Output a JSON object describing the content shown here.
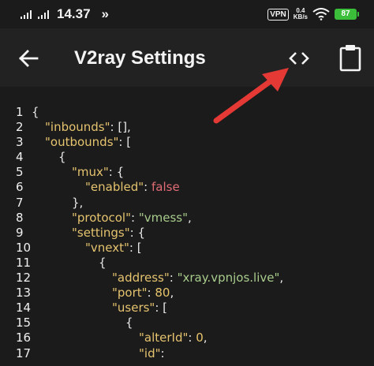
{
  "status_bar": {
    "time": "14.37",
    "overflow": "»",
    "vpn": "VPN",
    "net_speed_value": "0.4",
    "net_speed_unit": "KB/s",
    "battery": "87",
    "icons": [
      "signal-icon",
      "wifi-icon",
      "battery-icon"
    ]
  },
  "app_bar": {
    "title": "V2ray Settings",
    "back_icon": "arrow-left-icon",
    "code_icon": "code-brackets-icon",
    "clipboard_icon": "clipboard-icon"
  },
  "annotation": {
    "arrow_color": "#e53935"
  },
  "colors": {
    "key": "#e5c36f",
    "string": "#a8cc8c",
    "number": "#e8c56a",
    "boolean": "#e06c75",
    "background": "#1b1b1b"
  },
  "code": {
    "lines": [
      {
        "n": "1",
        "parts": [
          {
            "t": "{",
            "c": "p"
          }
        ]
      },
      {
        "n": "2",
        "parts": [
          {
            "t": "\"inbounds\"",
            "c": "k"
          },
          {
            "t": ": [],",
            "c": "p"
          }
        ]
      },
      {
        "n": "3",
        "parts": [
          {
            "t": "\"outbounds\"",
            "c": "k"
          },
          {
            "t": ": [",
            "c": "p"
          }
        ]
      },
      {
        "n": "4",
        "parts": [
          {
            "t": "{",
            "c": "p"
          }
        ]
      },
      {
        "n": "5",
        "parts": [
          {
            "t": "\"mux\"",
            "c": "k"
          },
          {
            "t": ": {",
            "c": "p"
          }
        ]
      },
      {
        "n": "6",
        "parts": [
          {
            "t": "\"enabled\"",
            "c": "k"
          },
          {
            "t": ": ",
            "c": "p"
          },
          {
            "t": "false",
            "c": "bool"
          }
        ]
      },
      {
        "n": "7",
        "parts": [
          {
            "t": "},",
            "c": "p"
          }
        ]
      },
      {
        "n": "8",
        "parts": [
          {
            "t": "\"protocol\"",
            "c": "k"
          },
          {
            "t": ": ",
            "c": "p"
          },
          {
            "t": "\"vmess\"",
            "c": "s"
          },
          {
            "t": ",",
            "c": "p"
          }
        ]
      },
      {
        "n": "9",
        "parts": [
          {
            "t": "\"settings\"",
            "c": "k"
          },
          {
            "t": ": {",
            "c": "p"
          }
        ]
      },
      {
        "n": "10",
        "parts": [
          {
            "t": "\"vnext\"",
            "c": "k"
          },
          {
            "t": ": [",
            "c": "p"
          }
        ]
      },
      {
        "n": "11",
        "parts": [
          {
            "t": "{",
            "c": "p"
          }
        ]
      },
      {
        "n": "12",
        "parts": [
          {
            "t": "\"address\"",
            "c": "k"
          },
          {
            "t": ": ",
            "c": "p"
          },
          {
            "t": "\"xray.vpnjos.live\"",
            "c": "s"
          },
          {
            "t": ",",
            "c": "p"
          }
        ]
      },
      {
        "n": "13",
        "parts": [
          {
            "t": "\"port\"",
            "c": "k"
          },
          {
            "t": ": ",
            "c": "p"
          },
          {
            "t": "80",
            "c": "n"
          },
          {
            "t": ",",
            "c": "p"
          }
        ]
      },
      {
        "n": "14",
        "parts": [
          {
            "t": "\"users\"",
            "c": "k"
          },
          {
            "t": ": [",
            "c": "p"
          }
        ]
      },
      {
        "n": "15",
        "parts": [
          {
            "t": "{",
            "c": "p"
          }
        ]
      },
      {
        "n": "16",
        "parts": [
          {
            "t": "\"alterId\"",
            "c": "k"
          },
          {
            "t": ": ",
            "c": "p"
          },
          {
            "t": "0",
            "c": "n"
          },
          {
            "t": ",",
            "c": "p"
          }
        ]
      },
      {
        "n": "17",
        "parts": [
          {
            "t": "\"id\"",
            "c": "k"
          },
          {
            "t": ":",
            "c": "p"
          }
        ]
      }
    ]
  }
}
